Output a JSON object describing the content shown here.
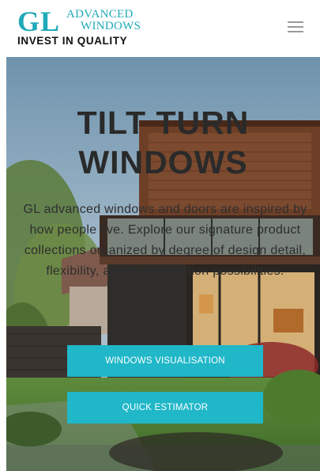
{
  "logo": {
    "initials": "GL",
    "line1": "ADVANCED",
    "line2": "WINDOWS",
    "tagline": "INVEST IN QUALITY"
  },
  "nav": {
    "menu_icon": "hamburger-menu-icon"
  },
  "hero": {
    "title_line1": "TILT TURN",
    "title_line2": "WINDOWS",
    "description": "GL advanced windows and doors are inspired by how people live. Explore our signature product collections organized by degree of design detail, flexibility, and customization possibilities.",
    "buttons": {
      "visualisation": "WINDOWS VISUALISATION",
      "estimator": "QUICK ESTIMATOR"
    }
  },
  "colors": {
    "brand": "#20a9b8",
    "button": "#20b7c8",
    "hamburger": "#9a9a9a"
  }
}
